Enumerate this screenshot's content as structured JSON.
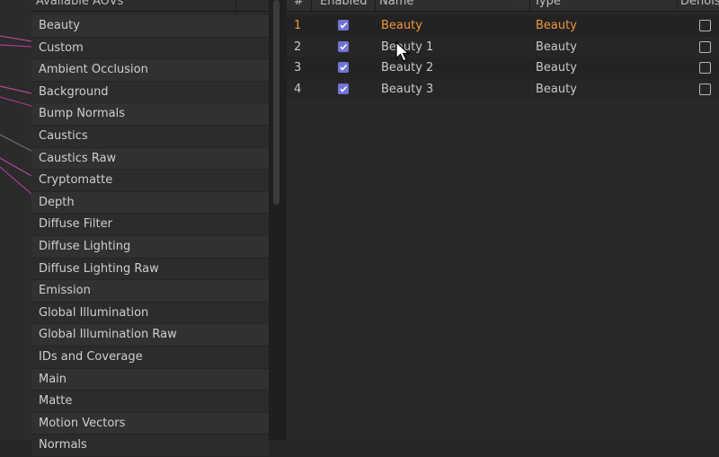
{
  "aov_panel": {
    "header": "Available AOVs",
    "items": [
      "Beauty",
      "Custom",
      "Ambient Occlusion",
      "Background",
      "Bump Normals",
      "Caustics",
      "Caustics Raw",
      "Cryptomatte",
      "Depth",
      "Diffuse Filter",
      "Diffuse Lighting",
      "Diffuse Lighting Raw",
      "Emission",
      "Global Illumination",
      "Global Illumination Raw",
      "IDs and Coverage",
      "Main",
      "Matte",
      "Motion Vectors",
      "Normals"
    ]
  },
  "layers_table": {
    "headers": {
      "num": "#",
      "enabled": "Enabled",
      "name": "Name",
      "type": "Type",
      "denoise": "Denoise"
    },
    "rows": [
      {
        "num": "1",
        "enabled": true,
        "name": "Beauty",
        "type": "Beauty",
        "denoise": false,
        "active": true
      },
      {
        "num": "2",
        "enabled": true,
        "name": "Beauty 1",
        "type": "Beauty",
        "denoise": false,
        "active": false
      },
      {
        "num": "3",
        "enabled": true,
        "name": "Beauty 2",
        "type": "Beauty",
        "denoise": false,
        "active": false
      },
      {
        "num": "4",
        "enabled": true,
        "name": "Beauty 3",
        "type": "Beauty",
        "denoise": false,
        "active": false
      }
    ]
  },
  "colors": {
    "accent_orange": "#f2953a",
    "checkbox_blue": "#6f74d6",
    "background": "#262626"
  }
}
